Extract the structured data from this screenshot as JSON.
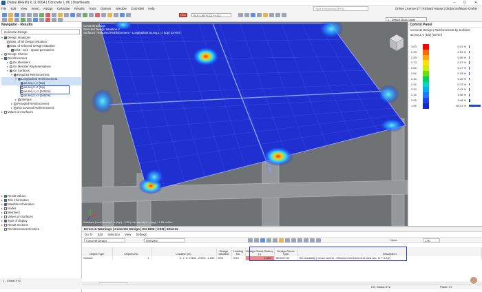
{
  "app": {
    "title": "Dlubal RFEM | 6.11.0004 | Concrete 1.rf6 | Downloads",
    "window_controls": "–  ☐  ✕",
    "menu": [
      "File",
      "Edit",
      "View",
      "Insert",
      "Assign",
      "Calculate",
      "Results",
      "Tools",
      "Options",
      "Window",
      "CAD-BIM",
      "Help"
    ],
    "search_placeholder": "Type a keyword (Alt+Q)",
    "license": "Online License 17 | Richard Haase | Dlubal Software GmbH",
    "lc_badge": "DS4",
    "lc_value": "SLS  1.35 * LC1 + LC2",
    "layer": "1 - Default Basic Layer"
  },
  "navigator": {
    "title": "Navigator - Results",
    "dropdown": "Concrete Design",
    "items": [
      "Design Situations",
      "Max. of all 'Design Situation'",
      "Max. of selected 'Design Situation'",
      "DS4 - SLS - Quasi-permanent",
      "Design Checks",
      "Reinforcement",
      "On Members",
      "On Member Representatives",
      "On Surfaces",
      "Required Reinforcement",
      "Longitudinal Reinforcement",
      "as,req,1,-z (top)",
      "as,req,2,-z (top)",
      "as,req,1,+z (bottom)",
      "as,req,2,+z (bottom)",
      "Stirrups",
      "Provided Reinforcement",
      "Not Covered Reinforcement",
      "Values on Surfaces"
    ],
    "bottom_items": [
      "Result Values",
      "Title Information",
      "Max/Min Information",
      "Nodes",
      "Members",
      "Values on Surfaces",
      "Type of display",
      "Result Sections",
      "Reinforcement Direction"
    ],
    "status": "1 - Global XYZ"
  },
  "view": {
    "header_line1": "Concrete Design",
    "header_line2": "Selected Design Situation 4",
    "header_line3": "Surfaces | Required Reinforcement - Longitudinal as,req,1,-z (top) [cm²/m]",
    "footer": "Surfaces | max as,req,1,-z (top) : 3.03 | min as,req,1,-z (top) : 1.95 cm²/m"
  },
  "control_panel": {
    "title": "Control Panel",
    "subtitle1": "Concrete Design | Reinforcement by Surfaces",
    "subtitle2": "as,req,1,-z (top) [cm²/m]",
    "legend": [
      {
        "value": "3.03",
        "color": "#ff0000",
        "pct": "0.01 %",
        "frac": 0.01
      },
      {
        "value": "2.93",
        "color": "#ff6a00",
        "pct": "0.03 %",
        "frac": 0.03
      },
      {
        "value": "2.83",
        "color": "#ffa800",
        "pct": "0.06 %",
        "frac": 0.06
      },
      {
        "value": "2.73",
        "color": "#ffe000",
        "pct": "0.07 %",
        "frac": 0.07
      },
      {
        "value": "2.64",
        "color": "#c8f000",
        "pct": "0.17 %",
        "frac": 0.17
      },
      {
        "value": "2.54",
        "color": "#66e000",
        "pct": "0.33 %",
        "frac": 0.33
      },
      {
        "value": "2.44",
        "color": "#00d060",
        "pct": "0.40 %",
        "frac": 0.4
      },
      {
        "value": "2.34",
        "color": "#00d8c0",
        "pct": "0.72 %",
        "frac": 0.72
      },
      {
        "value": "2.24",
        "color": "#00b0f0",
        "pct": "0.43 %",
        "frac": 0.43
      },
      {
        "value": "2.15",
        "color": "#1e78ff",
        "pct": "5.98 %",
        "frac": 5.98
      },
      {
        "value": "2.05",
        "color": "#1e46e6",
        "pct": "9.48 %",
        "frac": 9.48
      },
      {
        "value": "1.95",
        "color": "#1628c8",
        "pct": "85.01 %",
        "frac": 85.01
      }
    ]
  },
  "results": {
    "title": "Errors & Warnings | Concrete Design | EN 1992 | CEN | 2014-11",
    "menu": [
      "Go To",
      "Edit",
      "Selection",
      "View",
      "Settings"
    ],
    "dropdown1": "Concrete Design",
    "dropdown2": "Overview",
    "none_label": "None",
    "ratio_filter": "1.00",
    "columns": [
      "Object Type",
      "Objects No.",
      "Location (m)",
      "Design Situation",
      "Loading No.",
      "Design Check Ratio η [-]",
      "Design Check Type",
      "Description"
    ],
    "row": {
      "type": "Surface",
      "objects": "1",
      "location": "X, Y, Z: 2.806, -2.500, -1.000",
      "situation": "DS4",
      "loading": "CO4",
      "ratio": "1.585",
      "check_type": "SE0307.00",
      "description": "Serviceability | Crack control - Minimum reinforcement area acc. to 7.3.2(2)"
    },
    "pager": "1 of 2",
    "tab1": "Errors & Warnings",
    "tab2": "Not Valid / Deactivated"
  },
  "appstatus": {
    "cs": "CS: Global XYZ",
    "plane": "Plane: XY"
  }
}
